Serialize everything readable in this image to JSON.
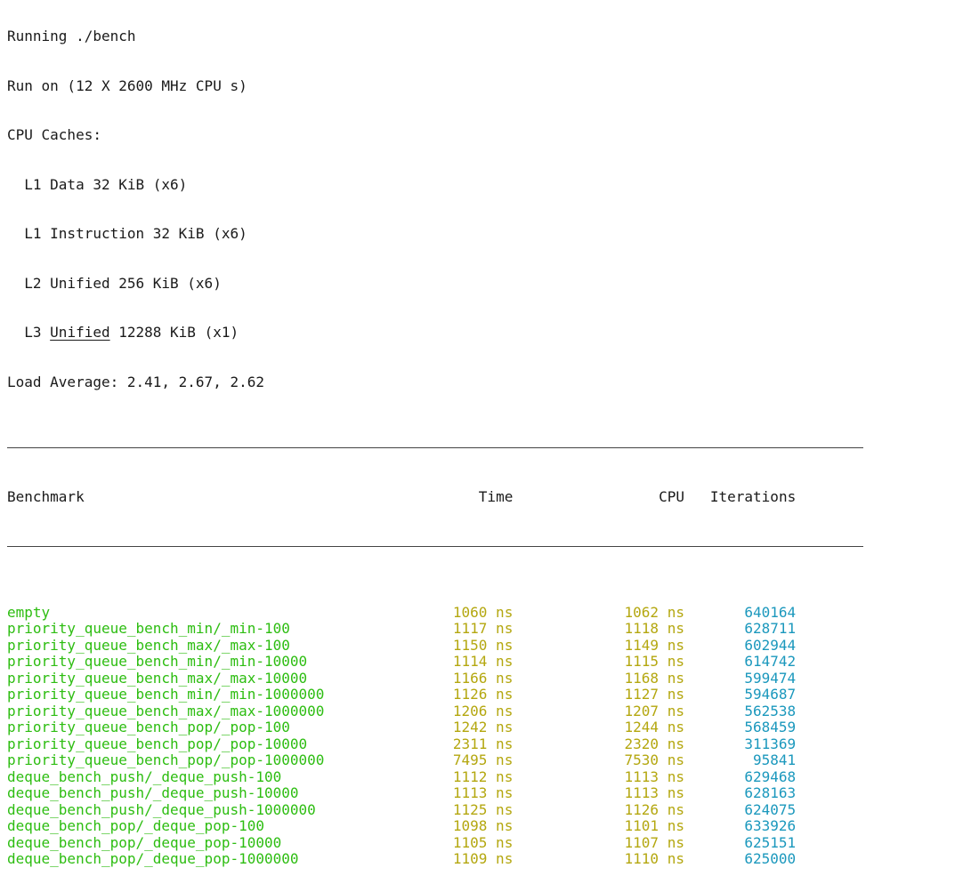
{
  "system_info": {
    "clipped_line": "Running ./bench",
    "run_on": "Run on (12 X 2600 MHz CPU s)",
    "cpu_caches_label": "CPU Caches:",
    "caches": {
      "l1_data": "  L1 Data 32 KiB (x6)",
      "l1_instruction": "  L1 Instruction 32 KiB (x6)",
      "l2": "  L2 Unified 256 KiB (x6)",
      "l3_prefix": "  L3 ",
      "l3_word": "Unified",
      "l3_suffix": " 12288 KiB (x1)"
    },
    "load_average": "Load Average: 2.41, 2.67, 2.62"
  },
  "table": {
    "headers": {
      "benchmark": "Benchmark",
      "time": "Time",
      "cpu": "CPU",
      "iterations": "Iterations"
    },
    "unit": " ns",
    "rows": [
      {
        "name": "empty",
        "time": "1060",
        "cpu": "1062",
        "iterations": "640164"
      },
      {
        "name": "priority_queue_bench_min/_min-100",
        "time": "1117",
        "cpu": "1118",
        "iterations": "628711"
      },
      {
        "name": "priority_queue_bench_max/_max-100",
        "time": "1150",
        "cpu": "1149",
        "iterations": "602944"
      },
      {
        "name": "priority_queue_bench_min/_min-10000",
        "time": "1114",
        "cpu": "1115",
        "iterations": "614742"
      },
      {
        "name": "priority_queue_bench_max/_max-10000",
        "time": "1166",
        "cpu": "1168",
        "iterations": "599474"
      },
      {
        "name": "priority_queue_bench_min/_min-1000000",
        "time": "1126",
        "cpu": "1127",
        "iterations": "594687"
      },
      {
        "name": "priority_queue_bench_max/_max-1000000",
        "time": "1206",
        "cpu": "1207",
        "iterations": "562538"
      },
      {
        "name": "priority_queue_bench_pop/_pop-100",
        "time": "1242",
        "cpu": "1244",
        "iterations": "568459"
      },
      {
        "name": "priority_queue_bench_pop/_pop-10000",
        "time": "2311",
        "cpu": "2320",
        "iterations": "311369"
      },
      {
        "name": "priority_queue_bench_pop/_pop-1000000",
        "time": "7495",
        "cpu": "7530",
        "iterations": "95841"
      },
      {
        "name": "deque_bench_push/_deque_push-100",
        "time": "1112",
        "cpu": "1113",
        "iterations": "629468"
      },
      {
        "name": "deque_bench_push/_deque_push-10000",
        "time": "1113",
        "cpu": "1113",
        "iterations": "628163"
      },
      {
        "name": "deque_bench_push/_deque_push-1000000",
        "time": "1125",
        "cpu": "1126",
        "iterations": "624075"
      },
      {
        "name": "deque_bench_pop/_deque_pop-100",
        "time": "1098",
        "cpu": "1101",
        "iterations": "633926"
      },
      {
        "name": "deque_bench_pop/_deque_pop-10000",
        "time": "1105",
        "cpu": "1107",
        "iterations": "625151"
      },
      {
        "name": "deque_bench_pop/_deque_pop-1000000",
        "time": "1109",
        "cpu": "1110",
        "iterations": "625000"
      }
    ]
  },
  "colors": {
    "name": "#2dbd11",
    "time": "#b4a70f",
    "iterations": "#1b98bd",
    "text": "#1a1a1a",
    "background": "#ffffff"
  }
}
